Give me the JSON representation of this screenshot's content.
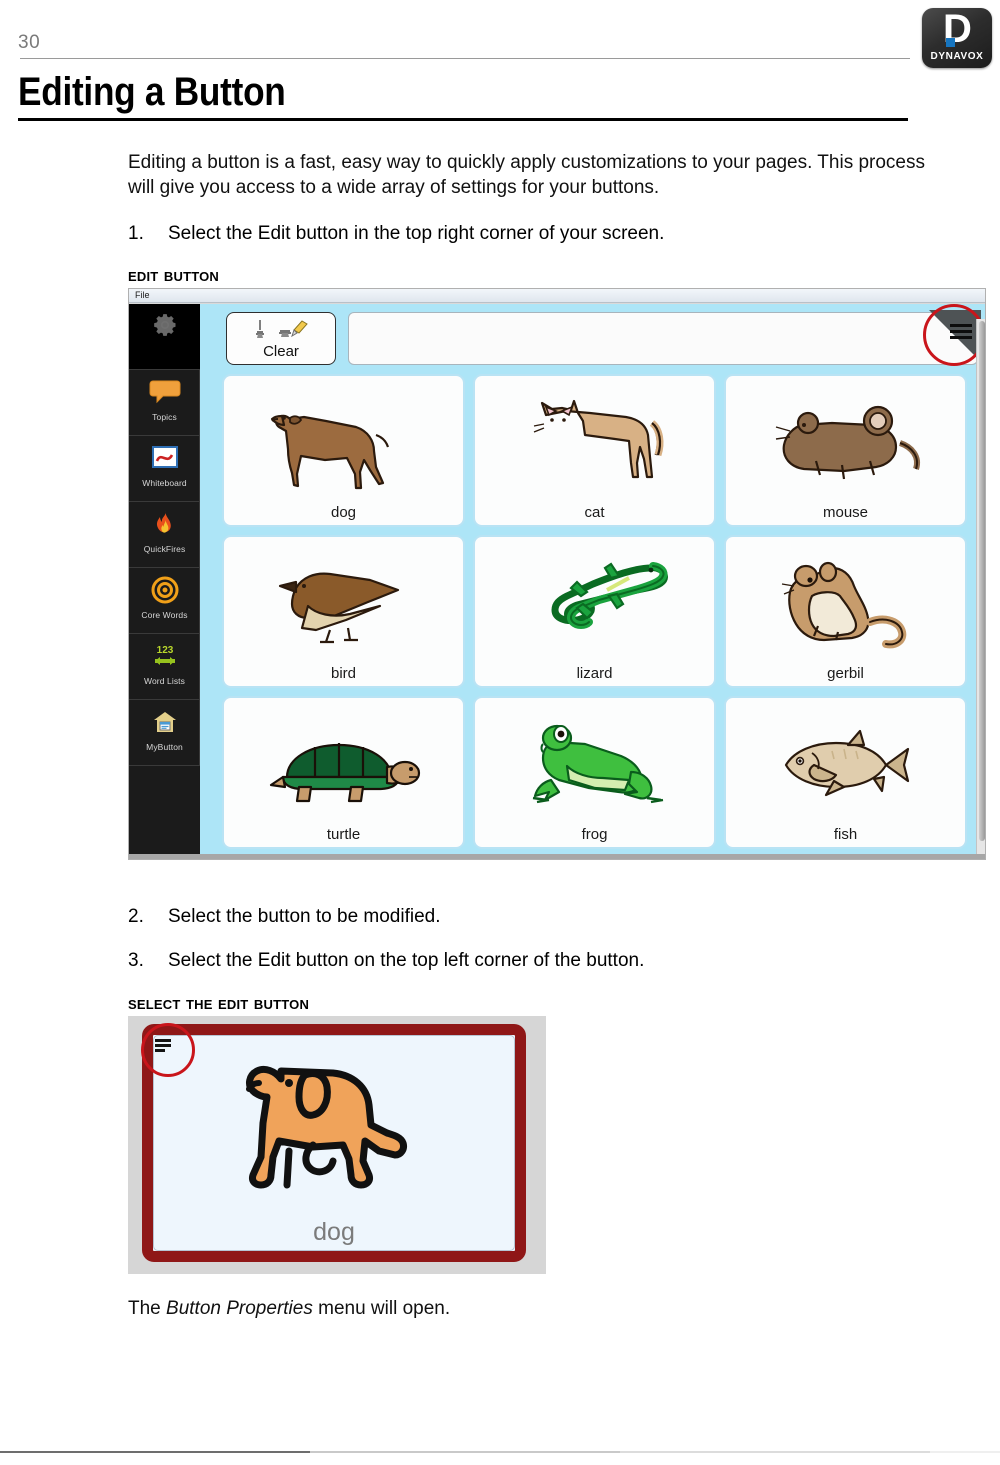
{
  "header": {
    "page_number": "30",
    "title": "Editing a Button",
    "logo": {
      "letter": "D",
      "wordmark": "DYNAVOX",
      "accent_color": "#1675c0",
      "icon_name": "dynavox-logo"
    }
  },
  "content": {
    "intro": "Editing a button is a fast, easy way to quickly apply customizations to your pages. This process will give you access to a wide array of settings for your buttons.",
    "steps": [
      {
        "number": "1.",
        "text": "Select the Edit button in the top right corner of your screen."
      },
      {
        "number": "2.",
        "text": "Select the button to be modified."
      },
      {
        "number": "3.",
        "text": "Select the Edit button on the top left corner of the button."
      }
    ],
    "captions": {
      "edit_button": "Edit Button",
      "select_the_edit_button": "Select the Edit button"
    },
    "closing_prefix": "The ",
    "closing_emphasis": "Button Properties",
    "closing_suffix": " menu will open."
  },
  "app_screenshot": {
    "menubar": {
      "file_label": "File"
    },
    "sidebar": {
      "items": [
        {
          "label": "",
          "icon_name": "gear-icon"
        },
        {
          "label": "Topics",
          "icon_name": "speech-bubble-icon"
        },
        {
          "label": "Whiteboard",
          "icon_name": "whiteboard-icon"
        },
        {
          "label": "QuickFires",
          "icon_name": "flame-icon"
        },
        {
          "label": "Core Words",
          "icon_name": "target-icon"
        },
        {
          "label": "Word Lists",
          "icon_name": "number-arrow-icon"
        },
        {
          "label": "MyButton",
          "icon_name": "house-page-icon"
        }
      ]
    },
    "toolbar": {
      "clear_label": "Clear",
      "clear_icon_name": "eraser-icon",
      "message_bar_value": "",
      "edit_button_icon_name": "hamburger-edit-icon"
    },
    "grid": {
      "buttons": [
        {
          "label": "dog",
          "icon_name": "dog-illustration"
        },
        {
          "label": "cat",
          "icon_name": "cat-illustration"
        },
        {
          "label": "mouse",
          "icon_name": "mouse-illustration"
        },
        {
          "label": "bird",
          "icon_name": "bird-illustration"
        },
        {
          "label": "lizard",
          "icon_name": "lizard-illustration"
        },
        {
          "label": "gerbil",
          "icon_name": "gerbil-illustration"
        },
        {
          "label": "turtle",
          "icon_name": "turtle-illustration"
        },
        {
          "label": "frog",
          "icon_name": "frog-illustration"
        },
        {
          "label": "fish",
          "icon_name": "fish-illustration"
        }
      ]
    },
    "background_color": "#ade5f7",
    "highlight_color": "#c9151b"
  },
  "selected_button_figure": {
    "label": "dog",
    "icon_name": "dog-orange-illustration",
    "edit_icon_name": "hamburger-edit-icon",
    "selection_border_color": "#8f1717",
    "highlight_color": "#c9151b"
  }
}
